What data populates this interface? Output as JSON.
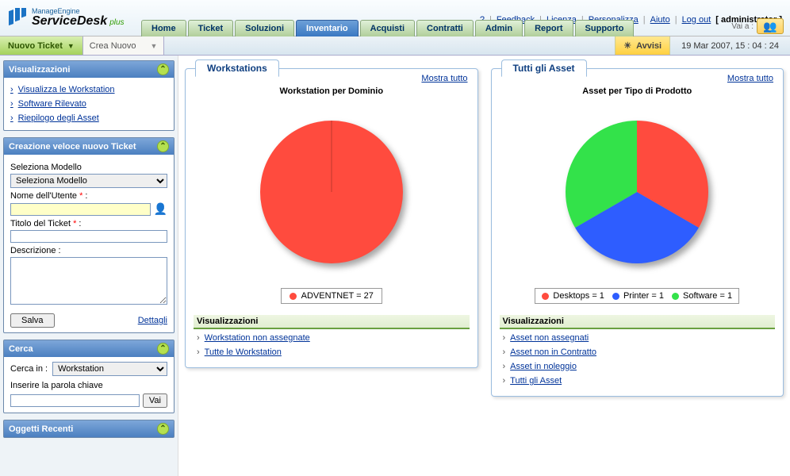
{
  "brand": {
    "manage": "ManageEngine",
    "product": "ServiceDesk",
    "suffix": "plus"
  },
  "toplinks": {
    "q": "?",
    "feedback": "Feedback",
    "licenza": "Licenza",
    "personalizza": "Personalizza",
    "aiuto": "Aiuto",
    "logout": "Log out",
    "user": "[ administrator ]"
  },
  "nav": {
    "tabs": [
      "Home",
      "Ticket",
      "Soluzioni",
      "Inventario",
      "Acquisti",
      "Contratti",
      "Admin",
      "Report",
      "Supporto"
    ],
    "active_index": 3,
    "goto_label": "Vai a :"
  },
  "actionbar": {
    "new_ticket": "Nuovo Ticket",
    "create_new": "Crea Nuovo",
    "avvisi": "Avvisi",
    "timestamp": "19 Mar 2007, 15 : 04 : 24"
  },
  "sidebar": {
    "visualizzazioni": {
      "title": "Visualizzazioni",
      "items": [
        "Visualizza le Workstation",
        "Software Rilevato",
        "Riepilogo degli Asset"
      ]
    },
    "quick_ticket": {
      "title": "Creazione veloce nuovo Ticket",
      "seleziona_label": "Seleziona Modello",
      "seleziona_option": "Seleziona Modello",
      "nome_label": "Nome dell'Utente",
      "titolo_label": "Titolo del Ticket",
      "descrizione_label": "Descrizione :",
      "salva": "Salva",
      "dettagli": "Dettagli"
    },
    "cerca": {
      "title": "Cerca",
      "cerca_in": "Cerca in :",
      "cerca_option": "Workstation",
      "keyword_label": "Inserire la parola chiave",
      "vai": "Vai"
    },
    "recenti": {
      "title": "Oggetti Recenti"
    }
  },
  "panels": {
    "left": {
      "title": "Workstations",
      "show_all": "Mostra tutto",
      "chart_caption": "Workstation per Dominio",
      "vis_title": "Visualizzazioni",
      "links": [
        "Workstation non assegnate",
        "Tutte le Workstation"
      ]
    },
    "right": {
      "title": "Tutti gli Asset",
      "show_all": "Mostra tutto",
      "chart_caption": "Asset per Tipo di Prodotto",
      "vis_title": "Visualizzazioni",
      "links": [
        "Asset non assegnati",
        "Asset non in Contratto",
        "Asset in noleggio",
        "Tutti gli Asset"
      ]
    }
  },
  "chart_data": [
    {
      "type": "pie",
      "title": "Workstation per Dominio",
      "series": [
        {
          "name": "ADVENTNET",
          "value": 27,
          "color": "#ff4b3e"
        }
      ],
      "legend_text": "ADVENTNET = 27"
    },
    {
      "type": "pie",
      "title": "Asset per Tipo di Prodotto",
      "series": [
        {
          "name": "Desktops",
          "value": 1,
          "color": "#ff4b3e"
        },
        {
          "name": "Printer",
          "value": 1,
          "color": "#2e5dff"
        },
        {
          "name": "Software",
          "value": 1,
          "color": "#33e24a"
        }
      ],
      "legend_entries": [
        {
          "label": "Desktops = 1",
          "color": "#ff4b3e"
        },
        {
          "label": "Printer = 1",
          "color": "#2e5dff"
        },
        {
          "label": "Software = 1",
          "color": "#33e24a"
        }
      ]
    }
  ]
}
